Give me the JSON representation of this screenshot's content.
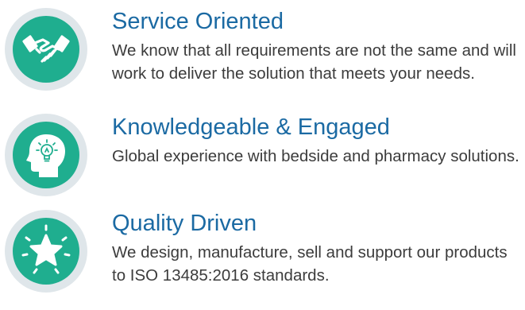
{
  "colors": {
    "accent_title": "#1b6aa3",
    "icon_fill": "#1fae8f",
    "icon_ring": "#dfe6ea",
    "body_text": "#3c3c3c"
  },
  "features": [
    {
      "icon": "handshake-icon",
      "title": "Service Oriented",
      "description": "We know that all requirements are not the same and will work to deliver the solution that meets your needs."
    },
    {
      "icon": "head-lightbulb-icon",
      "title": "Knowledgeable & Engaged",
      "description": "Global experience with bedside and pharmacy solutions."
    },
    {
      "icon": "star-icon",
      "title": "Quality Driven",
      "description": "We design, manufacture, sell and support our products to ISO 13485:2016 standards."
    }
  ]
}
